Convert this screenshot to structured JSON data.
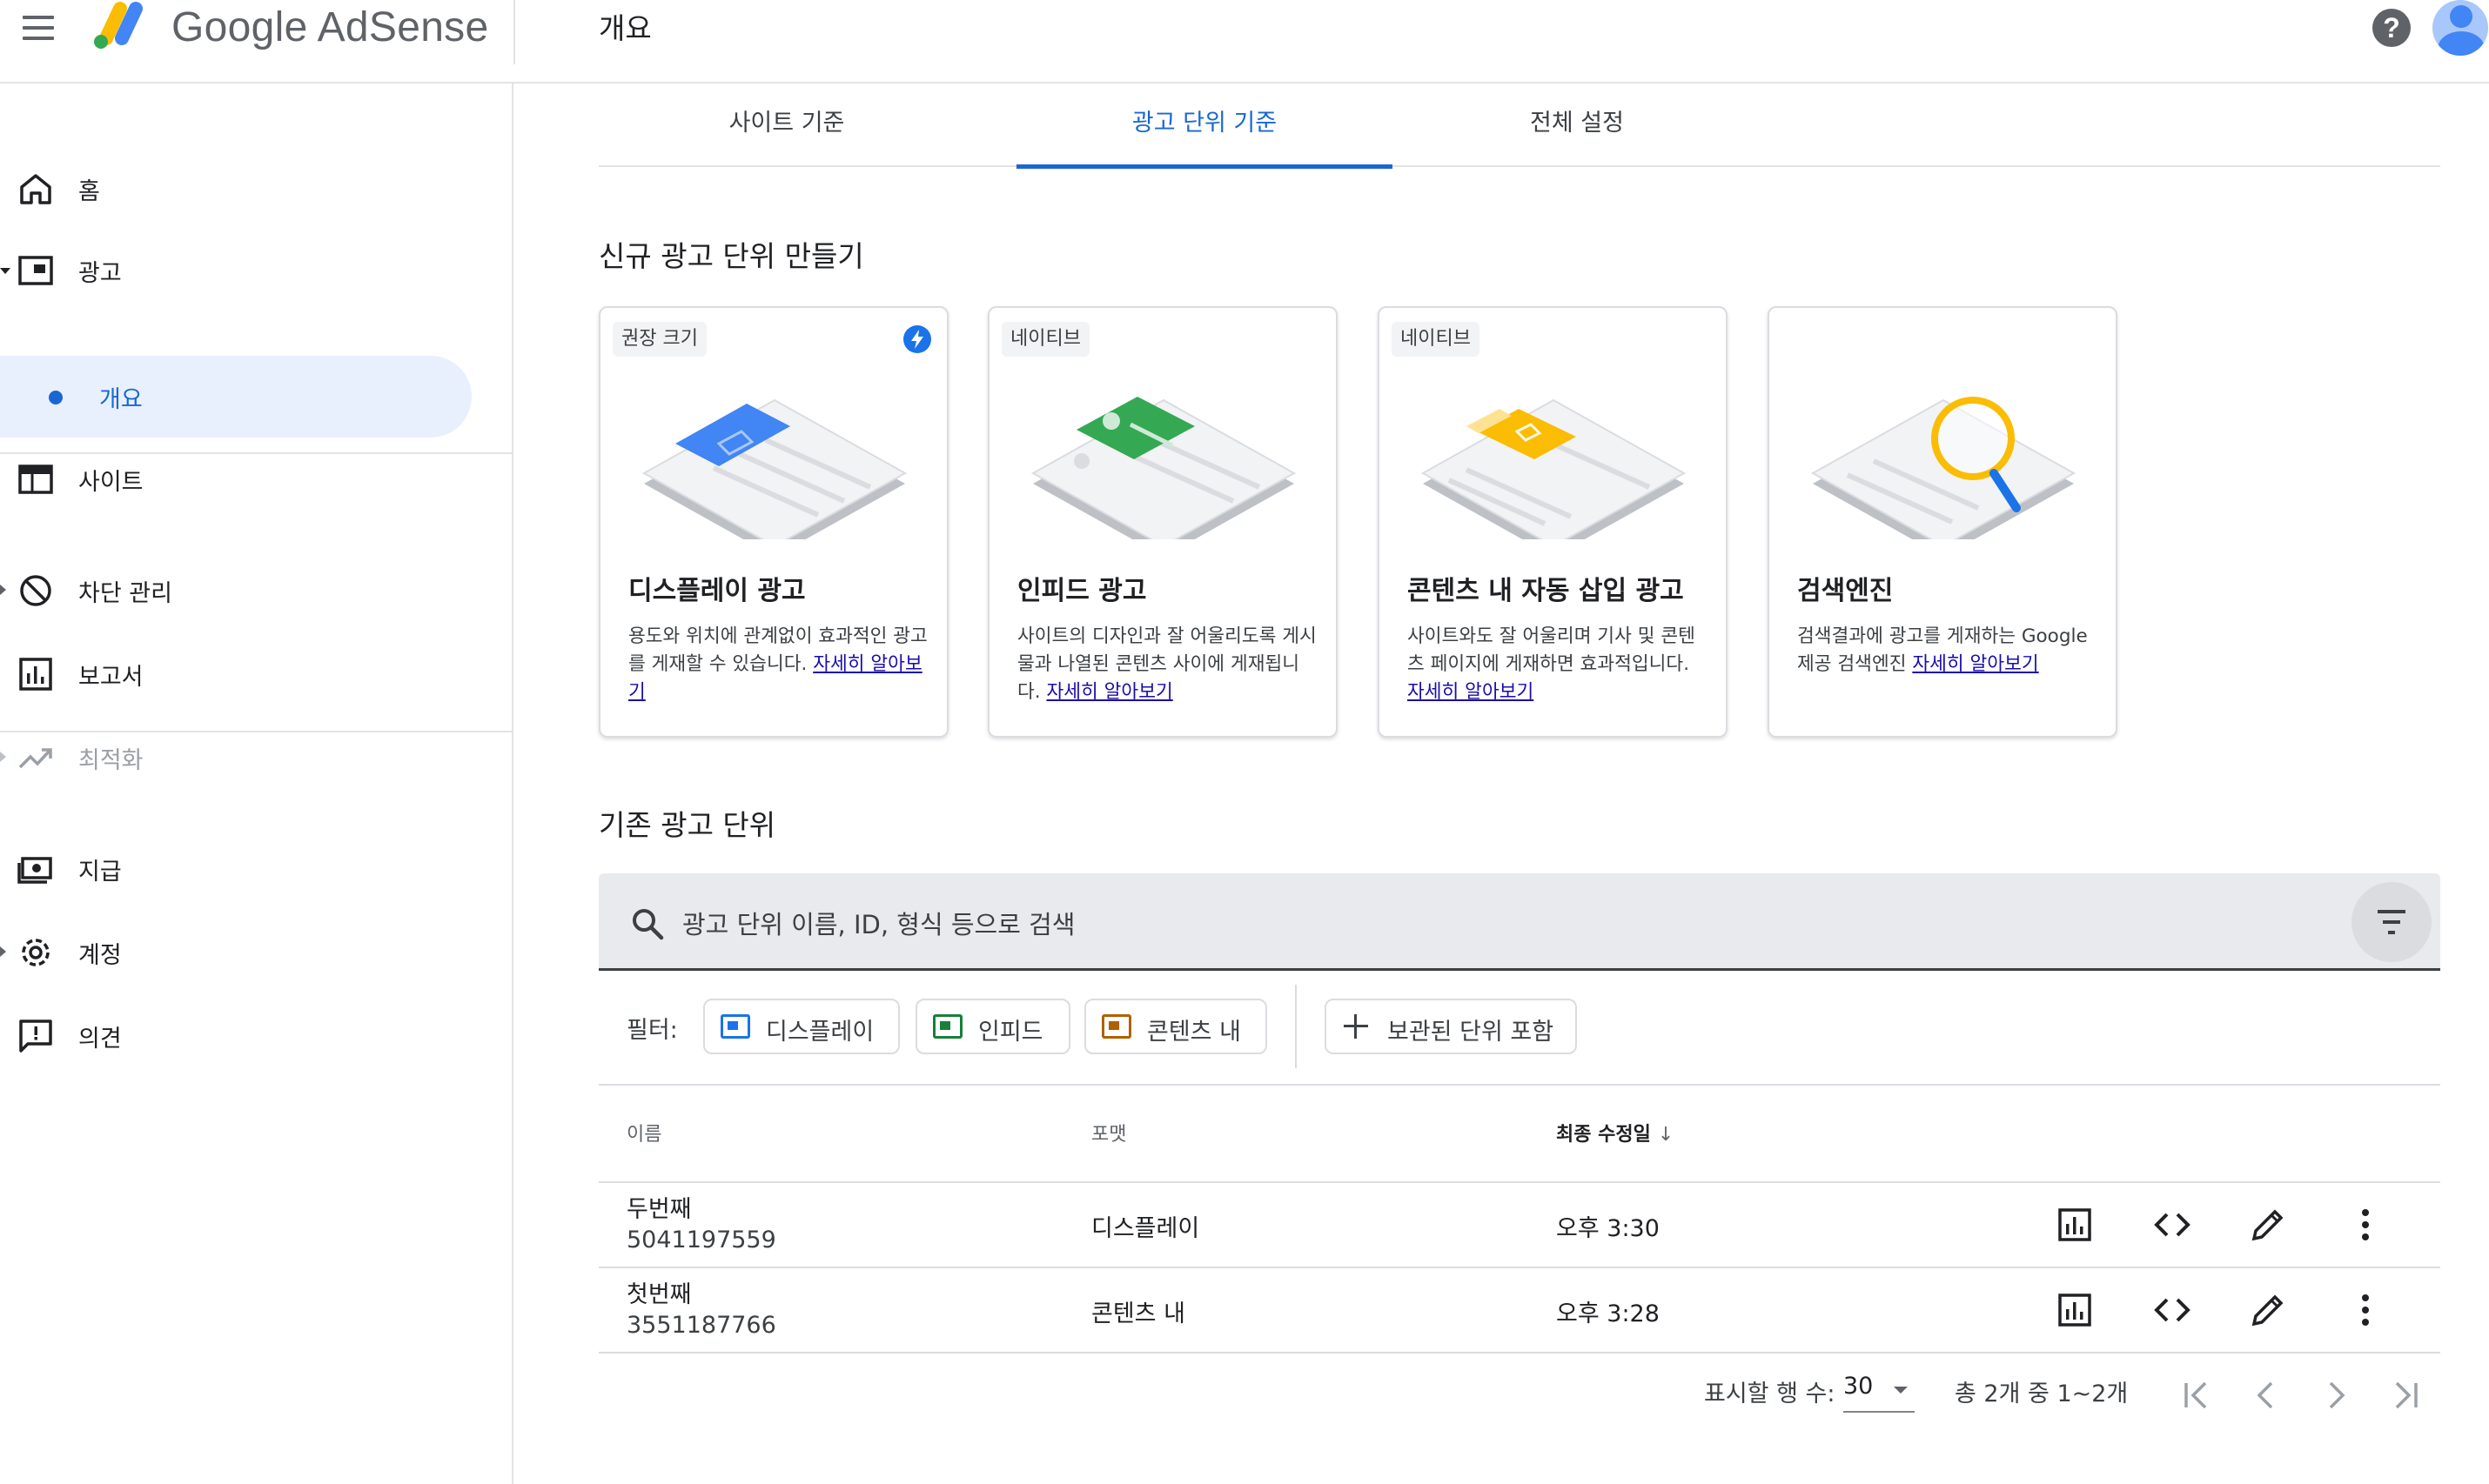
{
  "app": {
    "logo_text": "Google AdSense",
    "page_title": "개요"
  },
  "sidebar": {
    "items": [
      {
        "label": "홈",
        "icon": "home-icon"
      },
      {
        "label": "광고",
        "icon": "ads-icon"
      },
      {
        "label": "개요",
        "icon": "dot-icon"
      },
      {
        "label": "사이트",
        "icon": "sites-icon"
      },
      {
        "label": "차단 관리",
        "icon": "block-icon"
      },
      {
        "label": "보고서",
        "icon": "reports-icon"
      },
      {
        "label": "최적화",
        "icon": "optimization-icon"
      },
      {
        "label": "지급",
        "icon": "payments-icon"
      },
      {
        "label": "계정",
        "icon": "settings-icon"
      },
      {
        "label": "의견",
        "icon": "feedback-icon"
      }
    ]
  },
  "tabs": [
    {
      "label": "사이트 기준"
    },
    {
      "label": "광고 단위 기준"
    },
    {
      "label": "전체 설정"
    }
  ],
  "new_units": {
    "title": "신규 광고 단위 만들기",
    "cards": [
      {
        "chip": "권장 크기",
        "title": "디스플레이 광고",
        "desc": "용도와 위치에 관계없이 효과적인 광고를 게재할 수 있습니다.",
        "link": "자세히 알아보기",
        "accent": "#4285f4"
      },
      {
        "chip": "네이티브",
        "title": "인피드 광고",
        "desc": "사이트의 디자인과 잘 어울리도록 게시물과 나열된 콘텐츠 사이에 게재됩니다.",
        "link": "자세히 알아보기",
        "accent": "#34a853"
      },
      {
        "chip": "네이티브",
        "title": "콘텐츠 내 자동 삽입 광고",
        "desc": "사이트와도 잘 어울리며 기사 및 콘텐츠 페이지에 게재하면 효과적입니다.",
        "link": "자세히 알아보기",
        "accent": "#fbbc04"
      },
      {
        "title": "검색엔진",
        "desc": "검색결과에 광고를 게재하는 Google 제공 검색엔진",
        "link": "자세히 알아보기",
        "accent": "#fbbc04"
      }
    ]
  },
  "existing_units": {
    "title": "기존 광고 단위",
    "search_placeholder": "광고 단위 이름, ID, 형식 등으로 검색",
    "filter_label": "필터:",
    "filters": [
      "디스플레이",
      "인피드",
      "콘텐츠 내"
    ],
    "archived_label": "보관된 단위 포함",
    "columns": {
      "name": "이름",
      "format": "포맷",
      "modified": "최종 수정일",
      "sort_arrow": "↓"
    },
    "rows": [
      {
        "name": "두번째",
        "id": "5041197559",
        "format": "디스플레이",
        "modified": "오후 3:30"
      },
      {
        "name": "첫번째",
        "id": "3551187766",
        "format": "콘텐츠 내",
        "modified": "오후 3:28"
      }
    ]
  },
  "pagination": {
    "rows_label": "표시할 행 수:",
    "rows_value": "30",
    "range": "총 2개 중 1~2개"
  },
  "colors": {
    "accent": "#1967d2",
    "display": "#1a73e8",
    "infeed": "#188038",
    "inarticle": "#b06000"
  }
}
